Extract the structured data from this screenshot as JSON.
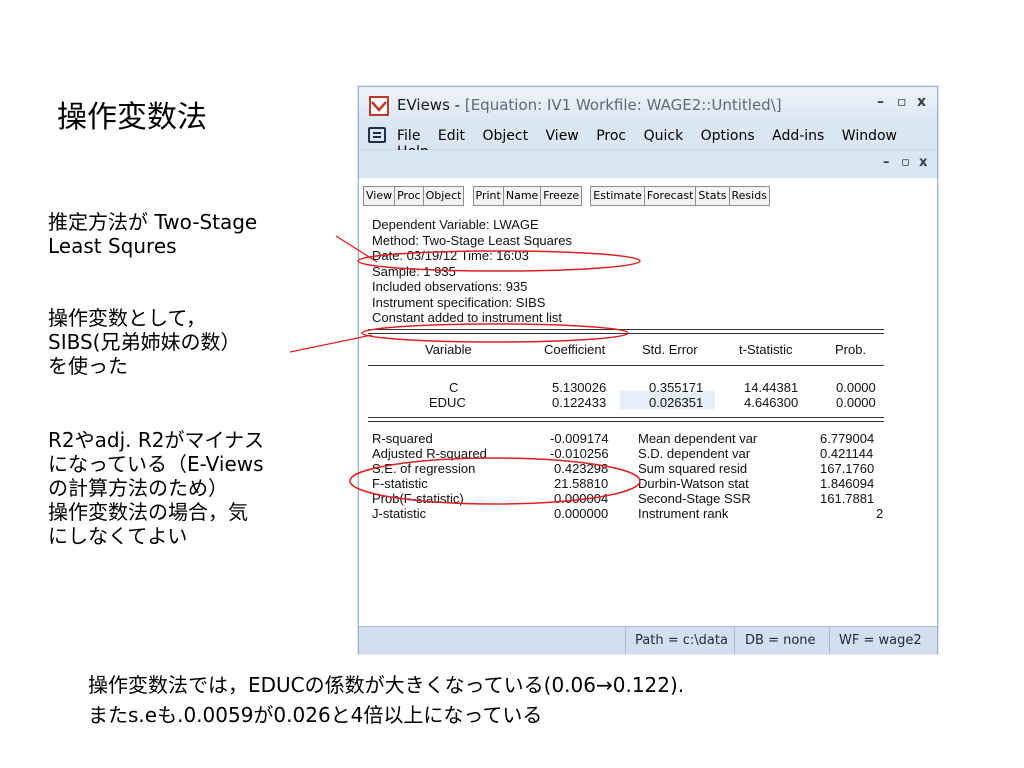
{
  "slide": {
    "title": "操作変数法",
    "note1": [
      "推定方法が Two-Stage",
      "Least Squres"
    ],
    "note2": [
      "操作変数として，",
      "SIBS(兄弟姉妹の数）",
      "を使った"
    ],
    "note3": [
      "R2やadj. R2がマイナス",
      "になっている（E-Views",
      "の計算方法のため）",
      "操作変数法の場合，気",
      "にしなくてよい"
    ],
    "bottom": [
      "操作変数法では，EDUCの係数が大きくなっている(0.06→0.122).",
      "またs.eも.0.0059が0.026と4倍以上になっている"
    ]
  },
  "window": {
    "app": "EViews - ",
    "title_rest": "[Equation: IV1   Workfile: WAGE2::Untitled\\]",
    "menu": [
      "File",
      "Edit",
      "Object",
      "View",
      "Proc",
      "Quick",
      "Options",
      "Add-ins",
      "Window",
      "Help"
    ],
    "toolbar_groups": [
      [
        "View",
        "Proc",
        "Object"
      ],
      [
        "Print",
        "Name",
        "Freeze"
      ],
      [
        "Estimate",
        "Forecast",
        "Stats",
        "Resids"
      ]
    ],
    "header": [
      "Dependent Variable: LWAGE",
      "Method: Two-Stage Least Squares",
      "Date: 03/19/12   Time: 16:03",
      "Sample: 1 935",
      "Included observations: 935",
      "Instrument specification: SIBS",
      "Constant added to instrument list"
    ],
    "table_headers": [
      "Variable",
      "Coefficient",
      "Std. Error",
      "t-Statistic",
      "Prob."
    ],
    "rows": [
      [
        "C",
        "5.130026",
        "0.355171",
        "14.44381",
        "0.0000"
      ],
      [
        "EDUC",
        "0.122433",
        "0.026351",
        "4.646300",
        "0.0000"
      ]
    ],
    "stats_left": [
      [
        "R-squared",
        "-0.009174"
      ],
      [
        "Adjusted R-squared",
        "-0.010256"
      ],
      [
        "S.E. of regression",
        "0.423298"
      ],
      [
        "F-statistic",
        "21.58810"
      ],
      [
        "Prob(F-statistic)",
        "0.000004"
      ],
      [
        "J-statistic",
        "0.000000"
      ]
    ],
    "stats_right": [
      [
        "Mean dependent var",
        "6.779004"
      ],
      [
        "S.D. dependent var",
        "0.421144"
      ],
      [
        "Sum squared resid",
        "167.1760"
      ],
      [
        "Durbin-Watson stat",
        "1.846094"
      ],
      [
        "Second-Stage SSR",
        "161.7881"
      ],
      [
        "Instrument rank",
        "2"
      ]
    ],
    "status": [
      "Path = c:\\data",
      "DB = none",
      "WF = wage2"
    ]
  },
  "colors": {
    "annotation": "#e02020",
    "titlebar": "#dbe6f3",
    "status": "#d3dff0"
  }
}
